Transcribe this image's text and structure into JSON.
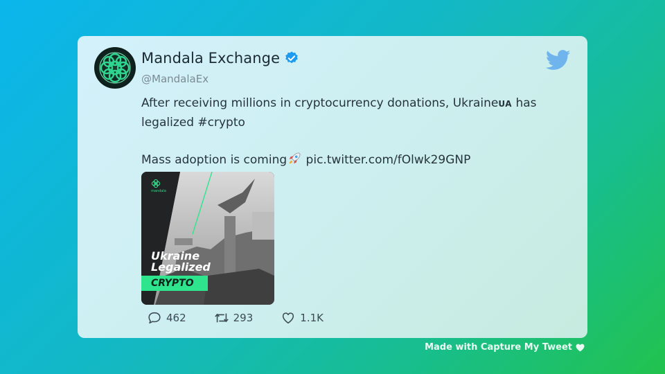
{
  "tweet": {
    "display_name": "Mandala Exchange",
    "handle": "@MandalaEx",
    "text_line1_a": "After receiving millions in cryptocurrency donations, Ukraine",
    "flag_text": "UA",
    "text_line1_b": " has",
    "text_line2": "legalized #crypto",
    "text_line3": "Mass adoption is coming",
    "link": " pic.twitter.com/fOlwk29GNP"
  },
  "media": {
    "brand_text": "mandala",
    "title_line1": "Ukraine",
    "title_line2": "Legalized",
    "tag": "CRYPTO"
  },
  "stats": {
    "replies": "462",
    "retweets": "293",
    "likes": "1.1K"
  },
  "footer": {
    "text": "Made with Capture My Tweet"
  },
  "colors": {
    "verified": "#1d9bf0",
    "twitter_blue": "#6fb4ec",
    "accent_green": "#2ee58e"
  },
  "icons": [
    "verified-badge-icon",
    "twitter-bird-icon",
    "rocket-icon",
    "reply-icon",
    "retweet-icon",
    "like-icon",
    "heart-icon"
  ]
}
